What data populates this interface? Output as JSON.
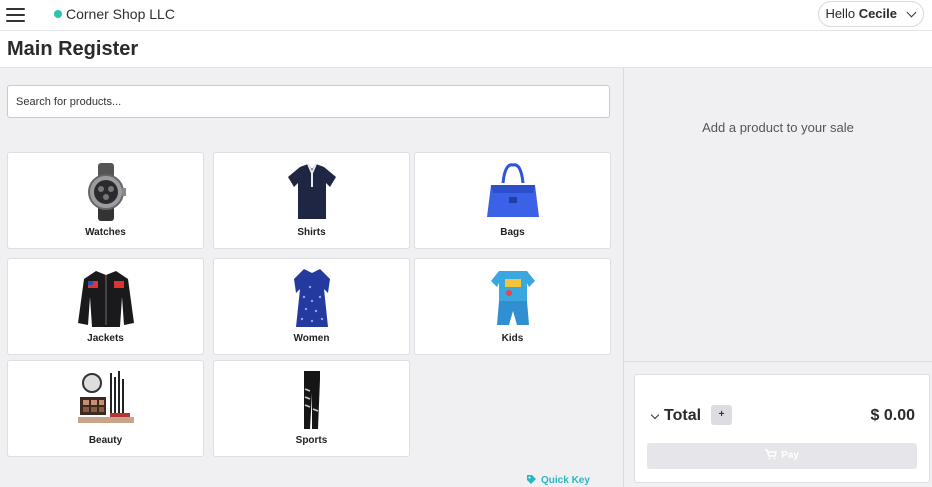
{
  "colors": {
    "status_dot": "#2bc4b4",
    "quick_key": "#2bb5c4",
    "background": "#f0f0f3"
  },
  "header": {
    "shop_name": "Corner Shop LLC",
    "greeting": "Hello",
    "user_name": "Cecile"
  },
  "page": {
    "title": "Main Register"
  },
  "search": {
    "placeholder": "Search for products...",
    "value": ""
  },
  "categories": [
    {
      "label": "Watches",
      "icon": "watch-icon"
    },
    {
      "label": "Shirts",
      "icon": "shirt-icon"
    },
    {
      "label": "Bags",
      "icon": "bag-icon"
    },
    {
      "label": "Jackets",
      "icon": "jacket-icon"
    },
    {
      "label": "Women",
      "icon": "dress-icon"
    },
    {
      "label": "Kids",
      "icon": "kids-outfit-icon"
    },
    {
      "label": "Beauty",
      "icon": "makeup-icon"
    },
    {
      "label": "Sports",
      "icon": "leggings-icon"
    }
  ],
  "quick_key": {
    "label": "Quick Key",
    "icon": "tag-icon"
  },
  "sale": {
    "empty_message": "Add a product to your sale",
    "total_label": "Total",
    "add_label": "+",
    "total_amount": "$ 0.00",
    "pay_label": "Pay",
    "pay_icon": "cart-icon"
  }
}
